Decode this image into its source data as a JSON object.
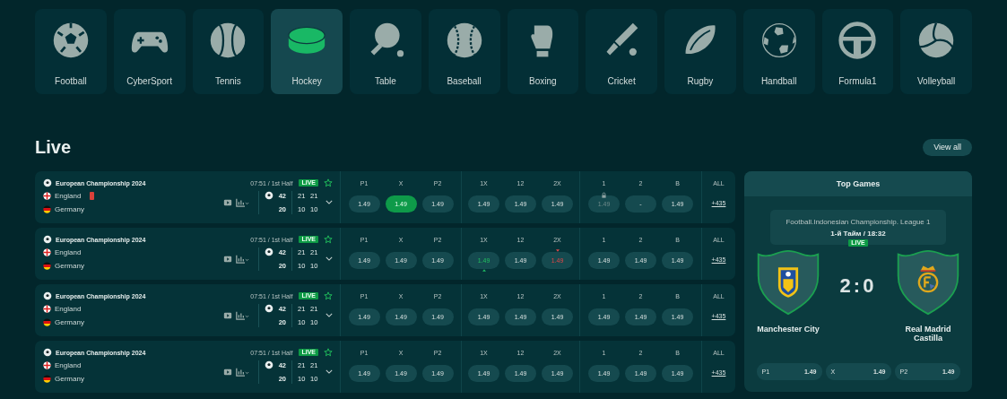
{
  "sports": [
    {
      "name": "Football",
      "selected": false
    },
    {
      "name": "CyberSport",
      "selected": false
    },
    {
      "name": "Tennis",
      "selected": false
    },
    {
      "name": "Hockey",
      "selected": true
    },
    {
      "name": "Table",
      "selected": false
    },
    {
      "name": "Baseball",
      "selected": false
    },
    {
      "name": "Boxing",
      "selected": false
    },
    {
      "name": "Cricket",
      "selected": false
    },
    {
      "name": "Rugby",
      "selected": false
    },
    {
      "name": "Handball",
      "selected": false
    },
    {
      "name": "Formula1",
      "selected": false
    },
    {
      "name": "Volleyball",
      "selected": false
    }
  ],
  "live": {
    "title": "Live",
    "view_all": "View all"
  },
  "matches": [
    {
      "league": "European Championship 2024",
      "time": "07:51 / 1st Half",
      "badge": "LIVE",
      "teams": [
        {
          "name": "England",
          "red_card": true
        },
        {
          "name": "Germany",
          "red_card": false
        }
      ],
      "score": [
        {
          "total": "42",
          "sets": [
            "21",
            "21"
          ]
        },
        {
          "total": "20",
          "sets": [
            "10",
            "10"
          ]
        }
      ],
      "markets": [
        [
          {
            "label": "P1",
            "value": "1.49",
            "kind": "normal",
            "selected": false
          },
          {
            "label": "X",
            "value": "1.49",
            "kind": "normal",
            "selected": true
          },
          {
            "label": "P2",
            "value": "1.49",
            "kind": "normal",
            "selected": false
          }
        ],
        [
          {
            "label": "1X",
            "value": "1.49",
            "kind": "normal",
            "selected": false
          },
          {
            "label": "12",
            "value": "1.49",
            "kind": "normal",
            "selected": false
          },
          {
            "label": "2X",
            "value": "1.49",
            "kind": "normal",
            "selected": false
          }
        ],
        [
          {
            "label": "1",
            "value": "1.49",
            "kind": "locked",
            "selected": false
          },
          {
            "label": "2",
            "value": "-",
            "kind": "normal",
            "selected": false
          },
          {
            "label": "B",
            "value": "1.49",
            "kind": "normal",
            "selected": false
          }
        ]
      ],
      "all_label": "ALL",
      "all_count": "+435"
    },
    {
      "league": "European Championship 2024",
      "time": "07:51 / 1st Half",
      "badge": "LIVE",
      "teams": [
        {
          "name": "England",
          "red_card": false
        },
        {
          "name": "Germany",
          "red_card": false
        }
      ],
      "score": [
        {
          "total": "42",
          "sets": [
            "21",
            "21"
          ]
        },
        {
          "total": "20",
          "sets": [
            "10",
            "10"
          ]
        }
      ],
      "markets": [
        [
          {
            "label": "P1",
            "value": "1.49",
            "kind": "normal",
            "selected": false
          },
          {
            "label": "X",
            "value": "1.49",
            "kind": "normal",
            "selected": false
          },
          {
            "label": "P2",
            "value": "1.49",
            "kind": "normal",
            "selected": false
          }
        ],
        [
          {
            "label": "1X",
            "value": "1.49",
            "kind": "rising",
            "selected": false
          },
          {
            "label": "12",
            "value": "1.49",
            "kind": "normal",
            "selected": false
          },
          {
            "label": "2X",
            "value": "1.49",
            "kind": "falling",
            "selected": false
          }
        ],
        [
          {
            "label": "1",
            "value": "1.49",
            "kind": "normal",
            "selected": false
          },
          {
            "label": "2",
            "value": "1.49",
            "kind": "normal",
            "selected": false
          },
          {
            "label": "B",
            "value": "1.49",
            "kind": "normal",
            "selected": false
          }
        ]
      ],
      "all_label": "ALL",
      "all_count": "+435"
    },
    {
      "league": "European Championship 2024",
      "time": "07:51 / 1st Half",
      "badge": "LIVE",
      "teams": [
        {
          "name": "England",
          "red_card": false
        },
        {
          "name": "Germany",
          "red_card": false
        }
      ],
      "score": [
        {
          "total": "42",
          "sets": [
            "21",
            "21"
          ]
        },
        {
          "total": "20",
          "sets": [
            "10",
            "10"
          ]
        }
      ],
      "markets": [
        [
          {
            "label": "P1",
            "value": "1.49",
            "kind": "normal",
            "selected": false
          },
          {
            "label": "X",
            "value": "1.49",
            "kind": "normal",
            "selected": false
          },
          {
            "label": "P2",
            "value": "1.49",
            "kind": "normal",
            "selected": false
          }
        ],
        [
          {
            "label": "1X",
            "value": "1.49",
            "kind": "normal",
            "selected": false
          },
          {
            "label": "12",
            "value": "1.49",
            "kind": "normal",
            "selected": false
          },
          {
            "label": "2X",
            "value": "1.49",
            "kind": "normal",
            "selected": false
          }
        ],
        [
          {
            "label": "1",
            "value": "1.49",
            "kind": "normal",
            "selected": false
          },
          {
            "label": "2",
            "value": "1.49",
            "kind": "normal",
            "selected": false
          },
          {
            "label": "B",
            "value": "1.49",
            "kind": "normal",
            "selected": false
          }
        ]
      ],
      "all_label": "ALL",
      "all_count": "+435"
    },
    {
      "league": "European Championship 2024",
      "time": "07:51 / 1st Half",
      "badge": "LIVE",
      "teams": [
        {
          "name": "England",
          "red_card": false
        },
        {
          "name": "Germany",
          "red_card": false
        }
      ],
      "score": [
        {
          "total": "42",
          "sets": [
            "21",
            "21"
          ]
        },
        {
          "total": "20",
          "sets": [
            "10",
            "10"
          ]
        }
      ],
      "markets": [
        [
          {
            "label": "P1",
            "value": "1.49",
            "kind": "normal",
            "selected": false
          },
          {
            "label": "X",
            "value": "1.49",
            "kind": "normal",
            "selected": false
          },
          {
            "label": "P2",
            "value": "1.49",
            "kind": "normal",
            "selected": false
          }
        ],
        [
          {
            "label": "1X",
            "value": "1.49",
            "kind": "normal",
            "selected": false
          },
          {
            "label": "12",
            "value": "1.49",
            "kind": "normal",
            "selected": false
          },
          {
            "label": "2X",
            "value": "1.49",
            "kind": "normal",
            "selected": false
          }
        ],
        [
          {
            "label": "1",
            "value": "1.49",
            "kind": "normal",
            "selected": false
          },
          {
            "label": "2",
            "value": "1.49",
            "kind": "normal",
            "selected": false
          },
          {
            "label": "B",
            "value": "1.49",
            "kind": "normal",
            "selected": false
          }
        ]
      ],
      "all_label": "ALL",
      "all_count": "+435"
    }
  ],
  "top_games": {
    "title": "Top Games",
    "league": "Football.Indonesian Championship. League 1",
    "period": "1-й Тайм / 18:32",
    "badge": "LIVE",
    "home": "Manchester City",
    "away": "Real Madrid Castilla",
    "score": "2:0",
    "odds": [
      {
        "label": "P1",
        "value": "1.49"
      },
      {
        "label": "X",
        "value": "1.49"
      },
      {
        "label": "P2",
        "value": "1.49"
      }
    ]
  }
}
